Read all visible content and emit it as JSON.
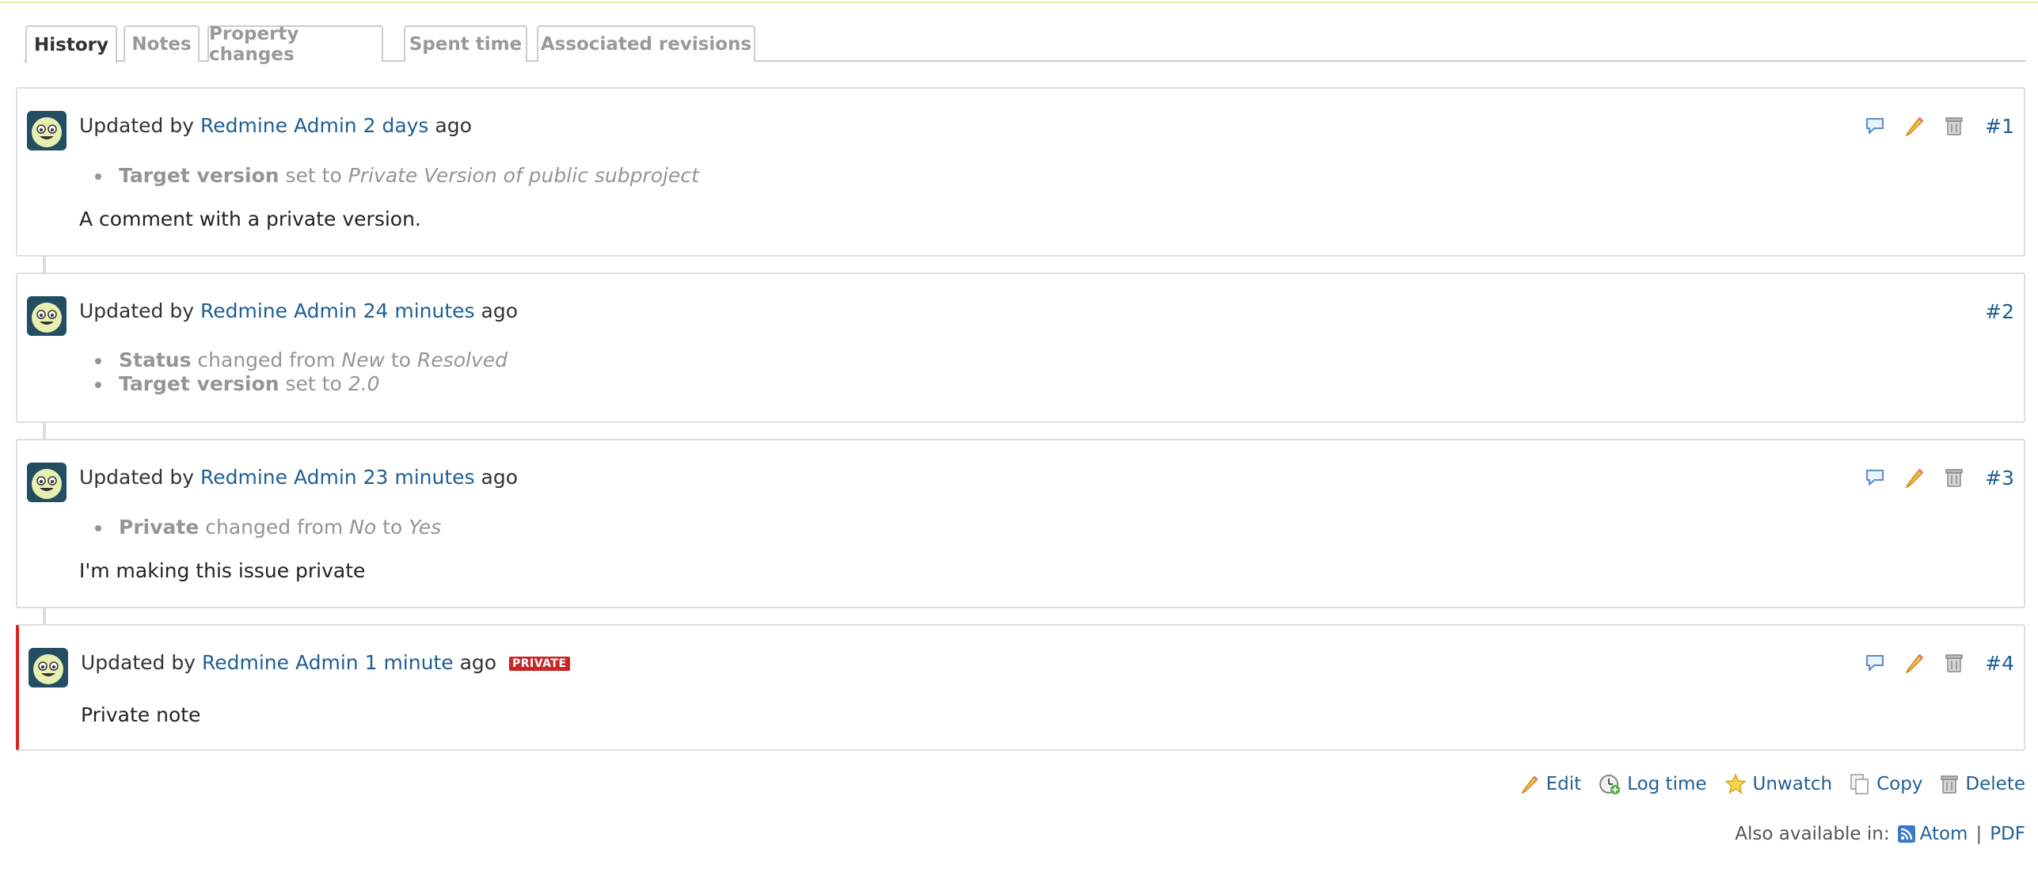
{
  "tabs": [
    {
      "label": "History",
      "selected": true
    },
    {
      "label": "Notes",
      "selected": false
    },
    {
      "label": "Property changes",
      "selected": false
    },
    {
      "label": "Spent time",
      "selected": false
    },
    {
      "label": "Associated revisions",
      "selected": false
    }
  ],
  "journals": [
    {
      "prefix": "Updated by",
      "author": "Redmine Admin",
      "time": "2 days",
      "suffix": "ago",
      "number": "#1",
      "details": [
        {
          "field": "Target version",
          "action": "set to",
          "new": "Private Version of public subproject"
        }
      ],
      "note": "A comment with a private version."
    },
    {
      "prefix": "Updated by",
      "author": "Redmine Admin",
      "time": "24 minutes",
      "suffix": "ago",
      "number": "#2",
      "details": [
        {
          "field": "Status",
          "action": "changed from",
          "old": "New",
          "to": "to",
          "new": "Resolved"
        },
        {
          "field": "Target version",
          "action": "set to",
          "new": "2.0"
        }
      ]
    },
    {
      "prefix": "Updated by",
      "author": "Redmine Admin",
      "time": "23 minutes",
      "suffix": "ago",
      "number": "#3",
      "details": [
        {
          "field": "Private",
          "action": "changed from",
          "old": "No",
          "to": "to",
          "new": "Yes"
        }
      ],
      "note": "I'm making this issue private"
    },
    {
      "prefix": "Updated by",
      "author": "Redmine Admin",
      "time": "1 minute",
      "suffix": "ago",
      "number": "#4",
      "badge": "PRIVATE",
      "note": "Private note"
    }
  ],
  "bottom_actions": {
    "edit": "Edit",
    "log_time": "Log time",
    "unwatch": "Unwatch",
    "copy": "Copy",
    "delete": "Delete"
  },
  "other_formats": {
    "label": "Also available in:",
    "atom": "Atom",
    "separator": "|",
    "pdf": "PDF"
  },
  "colors": {
    "link": "#1f5f95",
    "private_border": "#dd2222",
    "badge": "#c62828"
  }
}
